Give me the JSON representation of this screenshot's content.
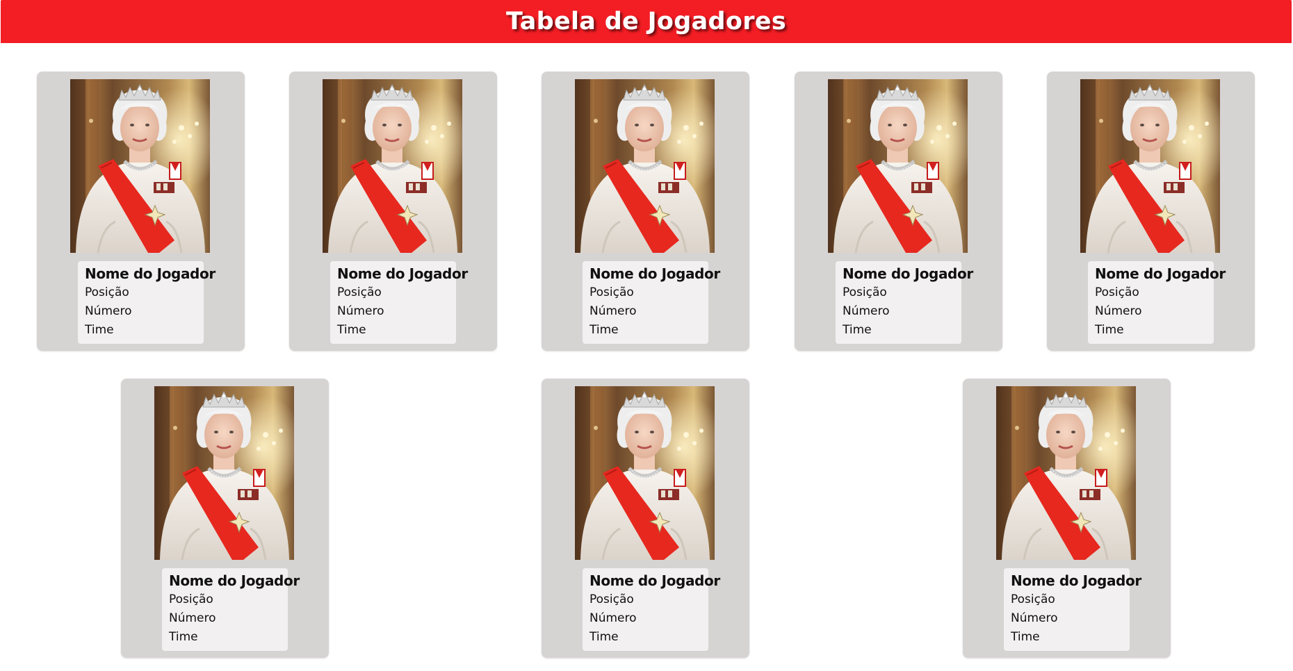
{
  "header": {
    "title": "Tabela de Jogadores"
  },
  "cards": [
    {
      "name": "Nome do Jogador",
      "position": "Posição",
      "number": "Número",
      "team": "Time"
    },
    {
      "name": "Nome do Jogador",
      "position": "Posição",
      "number": "Número",
      "team": "Time"
    },
    {
      "name": "Nome do Jogador",
      "position": "Posição",
      "number": "Número",
      "team": "Time"
    },
    {
      "name": "Nome do Jogador",
      "position": "Posição",
      "number": "Número",
      "team": "Time"
    },
    {
      "name": "Nome do Jogador",
      "position": "Posição",
      "number": "Número",
      "team": "Time"
    },
    {
      "name": "Nome do Jogador",
      "position": "Posição",
      "number": "Número",
      "team": "Time"
    },
    {
      "name": "Nome do Jogador",
      "position": "Posição",
      "number": "Número",
      "team": "Time"
    },
    {
      "name": "Nome do Jogador",
      "position": "Posição",
      "number": "Número",
      "team": "Time"
    }
  ],
  "colors": {
    "header_bg": "#f31d24",
    "card_bg": "#d6d3d3",
    "info_bg": "#f2f0f1"
  }
}
